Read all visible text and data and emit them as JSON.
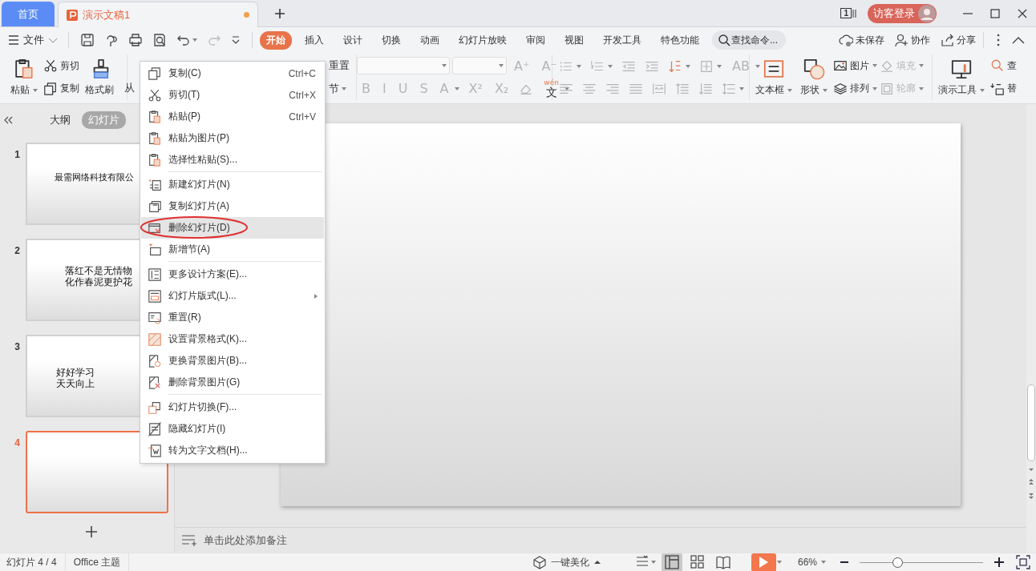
{
  "tabs": [
    {
      "label": "首页",
      "kind": "home",
      "selected": false
    },
    {
      "label": "演示文稿1",
      "kind": "document",
      "selected": true,
      "modified": true
    }
  ],
  "title_bar": {
    "window_count": "1",
    "login": "访客登录"
  },
  "menu_bar": {
    "file": "文件",
    "tabs": [
      {
        "label": "开始",
        "selected": true
      },
      {
        "label": "插入",
        "selected": false
      },
      {
        "label": "设计",
        "selected": false
      },
      {
        "label": "切换",
        "selected": false
      },
      {
        "label": "动画",
        "selected": false
      },
      {
        "label": "幻灯片放映",
        "selected": false
      },
      {
        "label": "审阅",
        "selected": false
      },
      {
        "label": "视图",
        "selected": false
      },
      {
        "label": "开发工具",
        "selected": false
      },
      {
        "label": "特色功能",
        "selected": false
      }
    ],
    "search": {
      "placeholder": "查找命令..."
    },
    "actions": [
      "未保存",
      "协作",
      "分享"
    ]
  },
  "ribbon": {
    "groups": [
      {
        "columns": [
          {
            "kind": "large",
            "items": [
              {
                "label": "粘贴",
                "dropdown": true
              }
            ]
          },
          {
            "kind": "stack",
            "upper": [
              {
                "label": "剪切",
                "kind": "small"
              }
            ],
            "lower": [
              {
                "label": "复制",
                "kind": "small"
              }
            ]
          },
          {
            "kind": "large",
            "items": [
              {
                "label": "格式刷"
              }
            ]
          }
        ]
      },
      {
        "columns": [
          {
            "kind": "text",
            "items": [
              {
                "label": "从"
              }
            ]
          },
          {
            "kind": "stack",
            "upper": [
              {
                "label": "重置",
                "kind": "text"
              }
            ],
            "lower": [
              {
                "label": "节",
                "kind": "text",
                "dropdown": true
              }
            ]
          }
        ]
      },
      {
        "columns": [
          {
            "kind": "stack",
            "upper": [
              {
                "kind": "combo",
                "disabled": true
              },
              {
                "kind": "combo",
                "disabled": true
              },
              {
                "glyph": "A⁺",
                "kind": "glyph",
                "disabled": true
              },
              {
                "glyph": "A⁻",
                "kind": "glyph",
                "disabled": true
              }
            ],
            "lower": [
              {
                "glyph": "B",
                "kind": "glyph",
                "disabled": true
              },
              {
                "glyph": "I",
                "kind": "glyph",
                "disabled": true
              },
              {
                "glyph": "U",
                "kind": "glyph",
                "disabled": true
              },
              {
                "glyph": "S",
                "kind": "glyph",
                "disabled": true
              },
              {
                "glyph": "A",
                "kind": "glyph",
                "dropdown": true,
                "disabled": true
              },
              {
                "glyph": "X²",
                "kind": "glyph",
                "disabled": true
              },
              {
                "glyph": "X₂",
                "kind": "glyph",
                "disabled": true
              },
              {
                "kind": "icon",
                "disabled": true
              },
              {
                "glyph": "文",
                "ruby": "wén",
                "kind": "glyph",
                "dropdown": true
              }
            ]
          }
        ]
      },
      {
        "columns": [
          {
            "kind": "stack",
            "upper": [
              {
                "kind": "icon",
                "dropdown": true,
                "disabled": true
              },
              {
                "kind": "icon",
                "dropdown": true,
                "disabled": true
              },
              {
                "kind": "icon",
                "disabled": true
              },
              {
                "kind": "icon",
                "disabled": true
              },
              {
                "kind": "icon",
                "dropdown": true
              },
              {
                "kind": "icon",
                "dropdown": true,
                "disabled": true
              },
              {
                "glyph": "AB",
                "kind": "glyph",
                "dropdown": true,
                "disabled": true
              }
            ],
            "lower": [
              {
                "kind": "icon",
                "disabled": true
              },
              {
                "kind": "icon",
                "disabled": true
              },
              {
                "kind": "icon",
                "disabled": true
              },
              {
                "kind": "icon",
                "disabled": true
              },
              {
                "kind": "icon",
                "disabled": true
              },
              {
                "kind": "icon",
                "disabled": true
              },
              {
                "kind": "icon",
                "disabled": true
              },
              {
                "kind": "icon",
                "dropdown": true,
                "disabled": true
              }
            ]
          }
        ]
      },
      {
        "columns": [
          {
            "kind": "large",
            "items": [
              {
                "label": "文本框",
                "dropdown": true
              }
            ]
          },
          {
            "kind": "large",
            "items": [
              {
                "label": "形状",
                "dropdown": true
              }
            ]
          },
          {
            "kind": "stack",
            "upper": [
              {
                "label": "图片",
                "kind": "small",
                "dropdown": true
              },
              {
                "label": "填充",
                "kind": "small",
                "dropdown": true,
                "disabled": true
              }
            ],
            "lower": [
              {
                "label": "排列",
                "kind": "small",
                "dropdown": true
              },
              {
                "label": "轮廓",
                "kind": "small",
                "dropdown": true,
                "disabled": true
              }
            ]
          }
        ]
      },
      {
        "columns": [
          {
            "kind": "large",
            "items": [
              {
                "label": "演示工具",
                "dropdown": true
              }
            ]
          },
          {
            "kind": "stack",
            "upper": [
              {
                "label": "查",
                "kind": "small"
              }
            ],
            "lower": [
              {
                "label": "替",
                "kind": "small"
              }
            ]
          }
        ]
      }
    ]
  },
  "panel": {
    "tabs": [
      {
        "label": "大纲",
        "selected": false
      },
      {
        "label": "幻灯片",
        "selected": true
      }
    ]
  },
  "slides": [
    {
      "number": "1",
      "lines": [
        "最需网络科技有限公"
      ],
      "selected": false
    },
    {
      "number": "2",
      "lines": [
        "落红不是无情物",
        "化作春泥更护花"
      ],
      "selected": false
    },
    {
      "number": "3",
      "lines": [
        "好好学习",
        "天天向上"
      ],
      "left_aligned": true,
      "selected": false
    },
    {
      "number": "4",
      "selected": true
    }
  ],
  "context_menu": {
    "groups": [
      [
        {
          "label": "复制(C)",
          "shortcut": "Ctrl+C",
          "highlighted": false
        },
        {
          "label": "剪切(T)",
          "shortcut": "Ctrl+X",
          "highlighted": false
        },
        {
          "label": "粘贴(P)",
          "shortcut": "Ctrl+V",
          "highlighted": false
        },
        {
          "label": "粘贴为图片(P)",
          "highlighted": false
        },
        {
          "label": "选择性粘贴(S)...",
          "highlighted": false
        }
      ],
      [
        {
          "label": "新建幻灯片(N)",
          "highlighted": false
        },
        {
          "label": "复制幻灯片(A)",
          "highlighted": false
        },
        {
          "label": "删除幻灯片(D)",
          "highlighted": true,
          "circled": true
        },
        {
          "label": "新增节(A)",
          "highlighted": false
        }
      ],
      [
        {
          "label": "更多设计方案(E)...",
          "highlighted": false
        },
        {
          "label": "幻灯片版式(L)...",
          "highlighted": false,
          "submenu": true
        },
        {
          "label": "重置(R)",
          "highlighted": false
        },
        {
          "label": "设置背景格式(K)...",
          "highlighted": false
        },
        {
          "label": "更换背景图片(B)...",
          "highlighted": false
        },
        {
          "label": "删除背景图片(G)",
          "highlighted": false
        }
      ],
      [
        {
          "label": "幻灯片切换(F)...",
          "highlighted": false
        },
        {
          "label": "隐藏幻灯片(I)",
          "highlighted": false
        },
        {
          "label": "转为文字文档(H)...",
          "highlighted": false
        }
      ]
    ]
  },
  "notes": {
    "placeholder": "单击此处添加备注"
  },
  "status_bar": {
    "slide": "幻灯片 4 / 4",
    "theme": "Office 主题",
    "beautify": "一键美化",
    "views": [
      {
        "selected": false
      },
      {
        "selected": true
      },
      {
        "selected": false
      },
      {
        "selected": false
      }
    ],
    "zoom": "66%",
    "zoom_slider": {
      "level": 0.31
    }
  }
}
